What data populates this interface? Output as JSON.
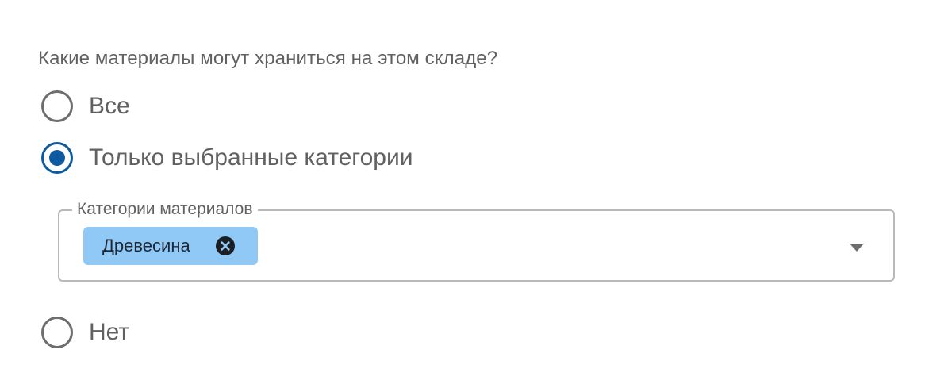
{
  "question": "Какие материалы могут храниться на этом складе?",
  "options": [
    {
      "label": "Все",
      "checked": false
    },
    {
      "label": "Только выбранные категории",
      "checked": true
    },
    {
      "label": "Нет",
      "checked": false
    }
  ],
  "categories_field": {
    "legend": "Категории материалов",
    "chips": [
      {
        "label": "Древесина",
        "remove_icon": "close-circle-icon"
      }
    ],
    "dropdown_icon": "caret-down-icon"
  },
  "colors": {
    "accent": "#0d5aa0",
    "chip_background": "#90c8f6",
    "text": "#616161",
    "border": "#b9b9b9"
  }
}
